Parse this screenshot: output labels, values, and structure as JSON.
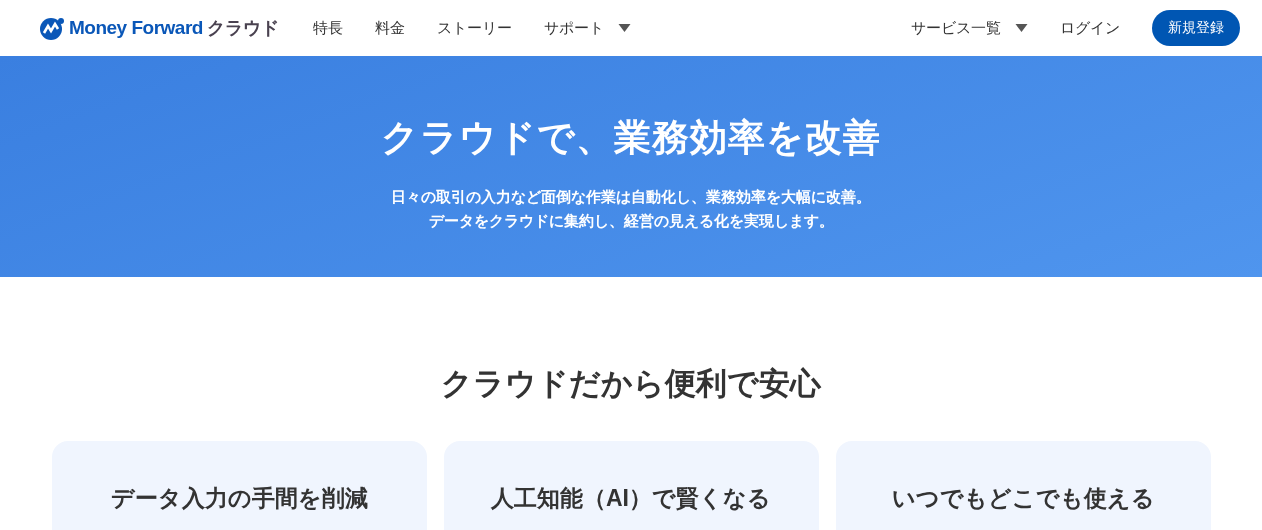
{
  "header": {
    "logo": {
      "brand": "Money Forward",
      "product": "クラウド"
    },
    "nav": [
      {
        "label": "特長",
        "kind": "link"
      },
      {
        "label": "料金",
        "kind": "link"
      },
      {
        "label": "ストーリー",
        "kind": "link"
      },
      {
        "label": "サポート",
        "kind": "dropdown"
      }
    ],
    "right_nav": [
      {
        "label": "サービス一覧",
        "kind": "dropdown"
      },
      {
        "label": "ログイン",
        "kind": "link"
      },
      {
        "label": "新規登録",
        "kind": "button"
      }
    ]
  },
  "hero": {
    "title": "クラウドで、業務効率を改善",
    "lines": [
      "日々の取引の入力など面倒な作業は自動化し、業務効率を大幅に改善。",
      "データをクラウドに集約し、経営の見える化を実現します。"
    ]
  },
  "section": {
    "title": "クラウドだから便利で安心",
    "cards": [
      {
        "title": "データ入力の手間を削減"
      },
      {
        "title": "人工知能（AI）で賢くなる"
      },
      {
        "title": "いつでもどこでも使える"
      }
    ]
  }
}
